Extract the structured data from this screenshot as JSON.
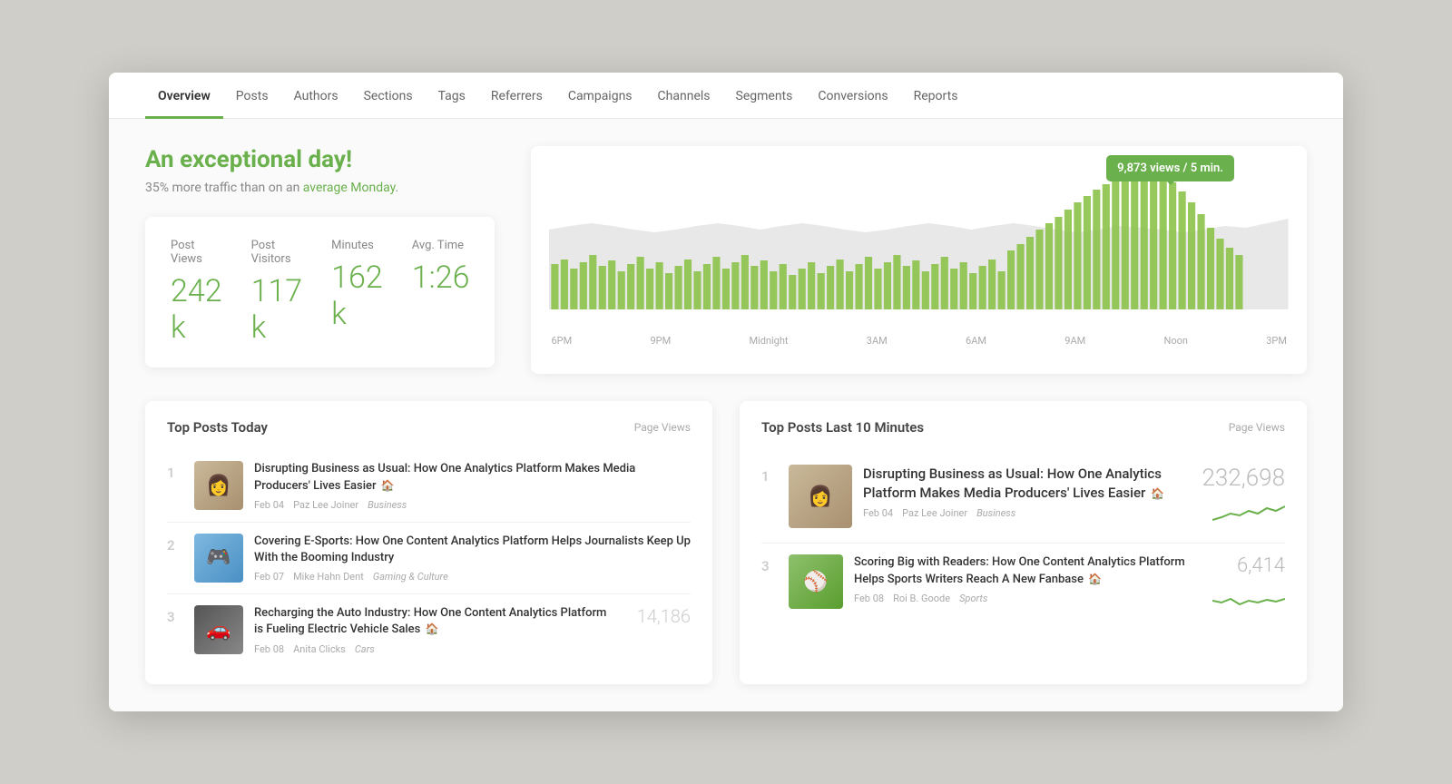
{
  "nav": {
    "items": [
      {
        "label": "Overview",
        "active": true
      },
      {
        "label": "Posts",
        "active": false
      },
      {
        "label": "Authors",
        "active": false
      },
      {
        "label": "Sections",
        "active": false
      },
      {
        "label": "Tags",
        "active": false
      },
      {
        "label": "Referrers",
        "active": false
      },
      {
        "label": "Campaigns",
        "active": false
      },
      {
        "label": "Channels",
        "active": false
      },
      {
        "label": "Segments",
        "active": false
      },
      {
        "label": "Conversions",
        "active": false
      },
      {
        "label": "Reports",
        "active": false
      }
    ]
  },
  "hero": {
    "tagline": "An exceptional day!",
    "subtitle": "35% more traffic than on an",
    "link_text": "average Monday",
    "link_suffix": "."
  },
  "stats": {
    "post_views_label": "Post Views",
    "post_views_value": "242 k",
    "post_visitors_label": "Post Visitors",
    "post_visitors_value": "117 k",
    "minutes_label": "Minutes",
    "minutes_value": "162 k",
    "avg_time_label": "Avg. Time",
    "avg_time_value": "1:26"
  },
  "chart": {
    "tooltip": "9,873 views / 5 min.",
    "time_labels": [
      "6PM",
      "9PM",
      "Midnight",
      "3AM",
      "6AM",
      "9AM",
      "Noon",
      "3PM"
    ]
  },
  "top_posts_today": {
    "title": "Top Posts Today",
    "col_label": "Page Views",
    "items": [
      {
        "rank": "1",
        "title": "Disrupting Business as Usual: How One Analytics Platform Makes Media Producers' Lives Easier",
        "date": "Feb 04",
        "author": "Paz Lee Joiner",
        "category": "Business",
        "has_home": true,
        "thumb_class": "thumb-1"
      },
      {
        "rank": "2",
        "title": "Covering E-Sports: How One Content Analytics Platform Helps Journalists Keep Up With the Booming Industry",
        "date": "Feb 07",
        "author": "Mike Hahn Dent",
        "category": "Gaming & Culture",
        "has_home": false,
        "thumb_class": "thumb-2"
      },
      {
        "rank": "3",
        "title": "Recharging the Auto Industry: How One Content Analytics Platform is Fueling Electric Vehicle Sales",
        "date": "Feb 08",
        "author": "Anita Clicks",
        "category": "Cars",
        "has_home": true,
        "thumb_class": "thumb-3"
      }
    ]
  },
  "top_posts_10min": {
    "title": "Top Posts Last 10 Minutes",
    "col_label": "Page Views",
    "items": [
      {
        "rank": "1",
        "title": "Disrupting Business as Usual: How One Analytics Platform Makes Media Producers' Lives Easier",
        "date": "Feb 04",
        "author": "Paz Lee Joiner",
        "category": "Business",
        "views": "232,698",
        "has_home": true,
        "thumb_class": "thumb-4",
        "sparkline": "high"
      },
      {
        "rank": "3",
        "title": "Scoring Big with Readers: How One Content Analytics Platform Helps Sports Writers Reach A New Fanbase",
        "date": "Feb 08",
        "author": "Roi B. Goode",
        "category": "Sports",
        "views": "6,414",
        "has_home": true,
        "thumb_class": "thumb-5",
        "sparkline": "low"
      }
    ]
  },
  "post_item_3_views": "14,186"
}
